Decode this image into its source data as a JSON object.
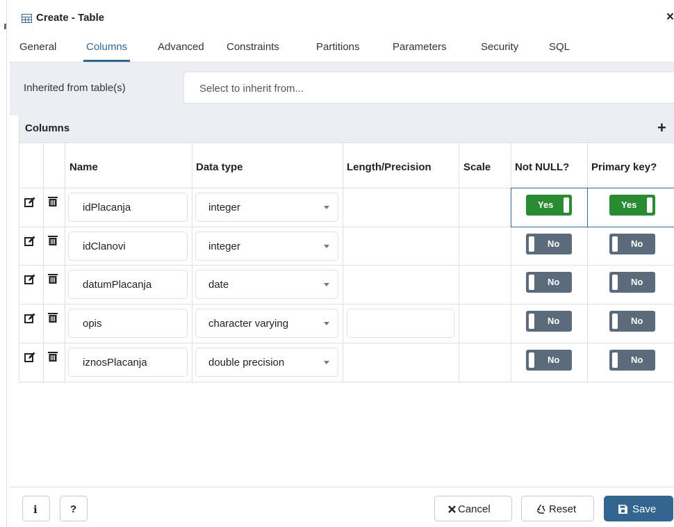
{
  "dialog": {
    "title": "Create - Table",
    "close_symbol": "×"
  },
  "tabs": [
    {
      "label": "General"
    },
    {
      "label": "Columns",
      "active": true
    },
    {
      "label": "Advanced"
    },
    {
      "label": "Constraints"
    },
    {
      "label": "Partitions"
    },
    {
      "label": "Parameters"
    },
    {
      "label": "Security"
    },
    {
      "label": "SQL"
    }
  ],
  "inherit": {
    "label": "Inherited from table(s)",
    "placeholder": "Select to inherit from..."
  },
  "columns_panel": {
    "title": "Columns",
    "add_symbol": "+",
    "headers": {
      "name": "Name",
      "data_type": "Data type",
      "length": "Length/Precision",
      "scale": "Scale",
      "not_null": "Not NULL?",
      "primary_key": "Primary key?"
    },
    "rows": [
      {
        "name": "idPlacanja",
        "data_type": "integer",
        "not_null": "Yes",
        "primary_key": "Yes"
      },
      {
        "name": "idClanovi",
        "data_type": "integer",
        "not_null": "No",
        "primary_key": "No"
      },
      {
        "name": "datumPlacanja",
        "data_type": "date",
        "not_null": "No",
        "primary_key": "No"
      },
      {
        "name": "opis",
        "data_type": "character varying",
        "not_null": "No",
        "primary_key": "No"
      },
      {
        "name": "iznosPlacanja",
        "data_type": "double precision",
        "not_null": "No",
        "primary_key": "No"
      }
    ]
  },
  "footer": {
    "info_label": "i",
    "help_label": "?",
    "cancel_label": "Cancel",
    "reset_label": "Reset",
    "save_label": "Save"
  },
  "colors": {
    "accent": "#326690",
    "toggle_on": "#2a8c32",
    "toggle_off": "#5b6b7b",
    "panel_bg": "#ebeef3"
  },
  "icons": [
    "table-icon",
    "close-icon",
    "add-icon",
    "edit-icon",
    "trash-icon",
    "dropdown-caret-icon",
    "info-icon",
    "help-icon",
    "cancel-x-icon",
    "reset-icon",
    "save-disk-icon"
  ]
}
